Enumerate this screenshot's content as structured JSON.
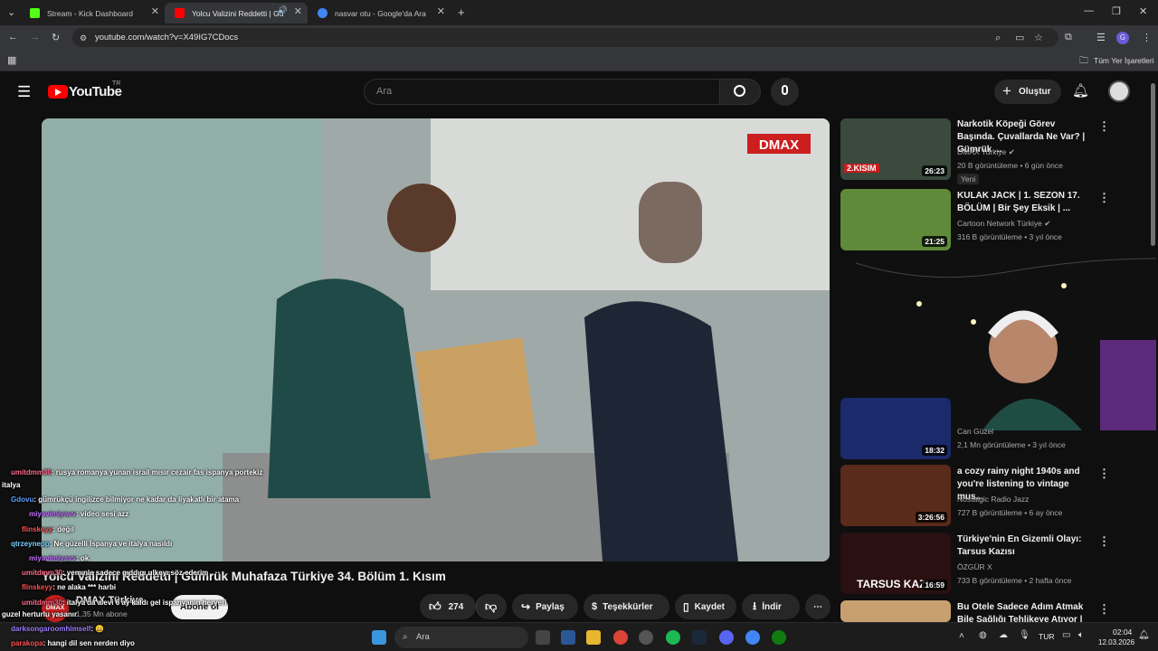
{
  "browser": {
    "tabs": [
      {
        "title": "Stream - Kick Dashboard",
        "fav_color": "#53fc18"
      },
      {
        "title": "Yolcu Valizini Reddetti | Gü",
        "fav_color": "#ff0000"
      },
      {
        "title": "nasvar otu - Google'da Ara",
        "fav_color": "#4285f4"
      }
    ],
    "url": "youtube.com/watch?v=X49IG7CDocs",
    "bookmarks_label": "Tüm Yer İşaretleri"
  },
  "youtube": {
    "logo_text": "YouTube",
    "region": "TR",
    "search_placeholder": "Ara",
    "create_label": "Oluştur",
    "video": {
      "title": "Yolcu Valizini Reddetti | Gümrük Muhafaza Türkiye 34. Bölüm 1. Kısım",
      "channel": "DMAX Türkiye",
      "subscribers": "1,35 Mn abone",
      "subscribe_label": "Abone ol",
      "likes": "274",
      "share_label": "Paylaş",
      "thanks_label": "Teşekkürler",
      "save_label": "Kaydet",
      "download_label": "İndir",
      "watermark": "DMAX"
    },
    "related": [
      {
        "title": "Narkotik Köpeği Görev Başında. Çuvallarda Ne Var? | Gümrük ...",
        "channel": "DMAX Turkiye",
        "meta": "20 B görüntüleme • 6 gün önce",
        "badge": "Yeni",
        "duration": "26:23",
        "thumb_text": "2.KISIM",
        "color": "#3a4a3c"
      },
      {
        "title": "KULAK JACK | 1. SEZON 17. BÖLÜM | Bir Şey Eksik | ...",
        "channel": "Cartoon Network Türkiye",
        "meta": "316 B görüntüleme • 3 yıl önce",
        "duration": "21:25",
        "color": "#5f8a3a"
      },
      {
        "title": "",
        "channel": "Can Güzel",
        "meta": "2,1 Mn görüntüleme • 3 yıl önce",
        "duration": "18:32",
        "color": "#1a2a6a"
      },
      {
        "title": "a cozy rainy night 1940s and you're listening to vintage mus...",
        "channel": "Nostalgic Radio Jazz",
        "meta": "727 B görüntüleme • 6 ay önce",
        "duration": "3:26:56",
        "color": "#5a2a1a"
      },
      {
        "title": "Türkiye'nin En Gizemli Olayı: Tarsus Kazısı",
        "channel": "ÖZGÜR X",
        "meta": "733 B görüntüleme • 2 hafta önce",
        "duration": "16:59",
        "thumb_text": "TARSUS KAZI",
        "color": "#2a1010"
      },
      {
        "title": "Bu Otele Sadece Adım Atmak Bile Sağlığı Tehlikeye Atıyor | B...",
        "color": "#c8a070"
      }
    ]
  },
  "chat": [
    {
      "user": "umitdmm30",
      "text": ": rusya romanya yunan israil mısır cezair fas ispanya portekiz",
      "color": "#ff6b8b"
    },
    {
      "user": "",
      "text": "italya",
      "color": "#fff"
    },
    {
      "user": "Gdovu",
      "text": ": gümrükçü ingilizce bilmiyor ne kadar da liyakatlı bir atama",
      "color": "#5aa0ff"
    },
    {
      "user": "miyavimiyavv",
      "text": ": video sesi azz",
      "color": "#c070ff"
    },
    {
      "user": "flinskeyy",
      "text": ": değil",
      "color": "#ff5050"
    },
    {
      "user": "qtrzeynepp",
      "text": ": Ne güzelli İspanya ve italya nasıldı",
      "color": "#7ad0ff"
    },
    {
      "user": "miyavimiyavv",
      "text": ": ok",
      "color": "#c070ff"
    },
    {
      "user": "umitdmm30",
      "text": ": yemınle sadece gıddıgı ulkeyı söz ederim",
      "color": "#ff6b8b"
    },
    {
      "user": "flinskeyy",
      "text": ": ne alaka *** harbi",
      "color": "#ff5050"
    },
    {
      "user": "umitdmm30",
      "text": ": italya'da alevi 6 ay kaldı gel ispanyanın heryeri",
      "color": "#ff6b8b"
    },
    {
      "user": "",
      "text": "guzel herturlu yasanır",
      "color": "#fff"
    },
    {
      "user": "darksongaroomhimself",
      "text": ": 😀",
      "color": "#9d7cff"
    },
    {
      "user": "parakopa",
      "text": ": hangi dil sen nerden diyo",
      "color": "#ff5050"
    }
  ],
  "taskbar": {
    "search_label": "Ara",
    "lang": "TUR",
    "time": "02:04",
    "date": "12.03.2026"
  }
}
